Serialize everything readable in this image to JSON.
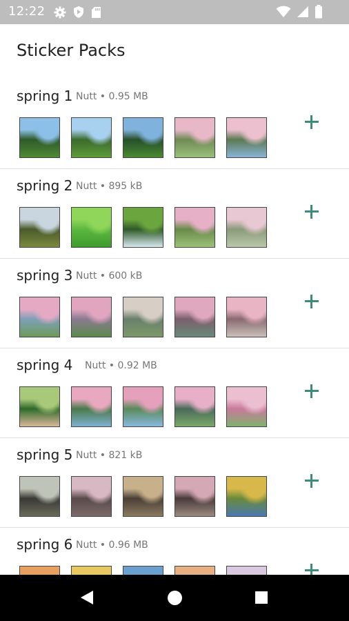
{
  "status_bar": {
    "time": "12:22",
    "icons": [
      "gear-icon",
      "play-protect-icon",
      "sd-card-icon",
      "wifi-icon",
      "signal-icon",
      "battery-icon"
    ]
  },
  "header": {
    "title": "Sticker Packs"
  },
  "packs": [
    {
      "name": "spring 1",
      "meta": "Nutt • 0.95 MB",
      "thumbs": [
        [
          "#2e5a2a",
          "#8cc0e8",
          "#4f8a34"
        ],
        [
          "#3b6b2c",
          "#a8d0ef",
          "#5e9b3a"
        ],
        [
          "#274f2a",
          "#7fb2dd",
          "#4a8a32"
        ],
        [
          "#6f8a55",
          "#e8b8c8",
          "#9bc07a"
        ],
        [
          "#5c7a52",
          "#ecc0cf",
          "#8ab4d8"
        ]
      ]
    },
    {
      "name": "spring 2",
      "meta": "Nutt • 895 kB",
      "thumbs": [
        [
          "#4a5a2a",
          "#c9d6df",
          "#7b8a3e"
        ],
        [
          "#5cb840",
          "#8fd65a",
          "#3f9a2e"
        ],
        [
          "#2f5a28",
          "#6aa53e",
          "#d8e8f0"
        ],
        [
          "#6a8a4a",
          "#e6b0c6",
          "#9cc27a"
        ],
        [
          "#8a9a7a",
          "#e8c8d2",
          "#b8c8a8"
        ]
      ]
    },
    {
      "name": "spring 3",
      "meta": "Nutt • 600 kB",
      "thumbs": [
        [
          "#7fa0b8",
          "#e6a9c3",
          "#6b9a5a"
        ],
        [
          "#8a7a90",
          "#e2a5bf",
          "#5d8a4d"
        ],
        [
          "#6a7f6a",
          "#d7cfc6",
          "#7c9a6a"
        ],
        [
          "#7a5f6a",
          "#e0a8be",
          "#6a8a7a"
        ],
        [
          "#8a6a72",
          "#e9b5c5",
          "#c9c0b8"
        ]
      ]
    },
    {
      "name": "spring 4",
      "meta": "Nutt • 0.92 MB",
      "thumbs": [
        [
          "#2f6a2a",
          "#a8c87a",
          "#d8b89a"
        ],
        [
          "#4a7a4a",
          "#e8a8c0",
          "#7fb0d0"
        ],
        [
          "#5a8a5a",
          "#e5a0bb",
          "#88b8dd"
        ],
        [
          "#4a6a5a",
          "#e8b0c8",
          "#7aa86a"
        ],
        [
          "#c87a9a",
          "#ecbfd0",
          "#7fb070"
        ]
      ]
    },
    {
      "name": "spring 5",
      "meta": "Nutt • 821 kB",
      "thumbs": [
        [
          "#3a3a35",
          "#bfc4b8",
          "#6a6a5a"
        ],
        [
          "#5a4a4a",
          "#d8b8c2",
          "#7a6a68"
        ],
        [
          "#4a3f35",
          "#c8b08a",
          "#8a7a60"
        ],
        [
          "#4a3a3a",
          "#d4a8b4",
          "#9a8a80"
        ],
        [
          "#6a8a3a",
          "#d8b84a",
          "#4a7ab0"
        ]
      ]
    },
    {
      "name": "spring 6",
      "meta": "Nutt • 0.96 MB",
      "thumbs": [
        [
          "#3a6ab0",
          "#e8a060",
          "#5a8a3a"
        ],
        [
          "#5aa0c8",
          "#e8c860",
          "#6aa050"
        ],
        [
          "#c8a060",
          "#6aa0d0",
          "#4a8a3a"
        ],
        [
          "#4a80b8",
          "#e8b080",
          "#5a9a4a"
        ],
        [
          "#e8d8a0",
          "#d8c8e0",
          "#b8a8c8"
        ]
      ]
    }
  ],
  "nav_bar": {
    "icons": [
      "back-icon",
      "home-icon",
      "recents-icon"
    ]
  }
}
